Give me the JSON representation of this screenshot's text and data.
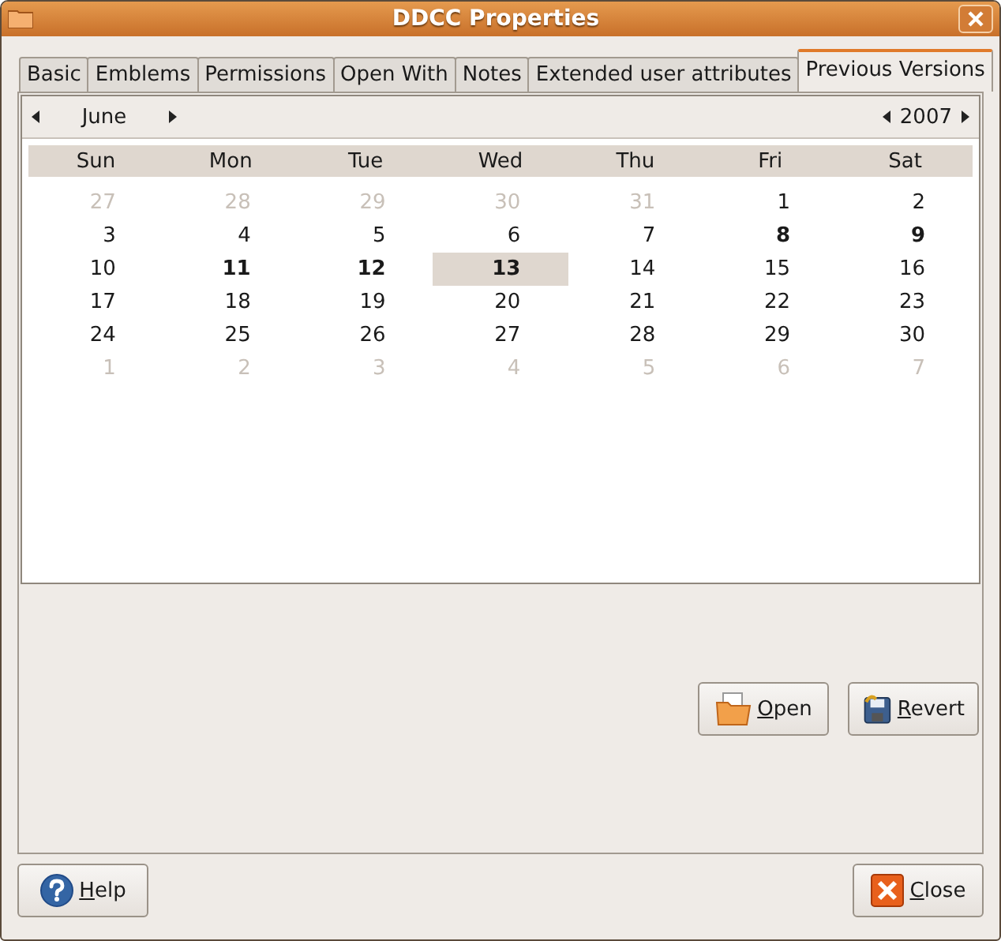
{
  "window": {
    "title": "DDCC Properties"
  },
  "tabs": [
    {
      "label": "Basic",
      "selected": false
    },
    {
      "label": "Emblems",
      "selected": false
    },
    {
      "label": "Permissions",
      "selected": false
    },
    {
      "label": "Open With",
      "selected": false
    },
    {
      "label": "Notes",
      "selected": false
    },
    {
      "label": "Extended user attributes",
      "selected": false
    },
    {
      "label": "Previous Versions",
      "selected": true
    }
  ],
  "calendar": {
    "month": "June",
    "year": "2007",
    "weekdays": [
      "Sun",
      "Mon",
      "Tue",
      "Wed",
      "Thu",
      "Fri",
      "Sat"
    ],
    "weeks": [
      [
        {
          "day": "27",
          "kind": "other",
          "marked": false,
          "selected": false
        },
        {
          "day": "28",
          "kind": "other",
          "marked": false,
          "selected": false
        },
        {
          "day": "29",
          "kind": "other",
          "marked": false,
          "selected": false
        },
        {
          "day": "30",
          "kind": "other",
          "marked": false,
          "selected": false
        },
        {
          "day": "31",
          "kind": "other",
          "marked": false,
          "selected": false
        },
        {
          "day": "1",
          "kind": "current",
          "marked": false,
          "selected": false
        },
        {
          "day": "2",
          "kind": "current",
          "marked": false,
          "selected": false
        }
      ],
      [
        {
          "day": "3",
          "kind": "current",
          "marked": false,
          "selected": false
        },
        {
          "day": "4",
          "kind": "current",
          "marked": false,
          "selected": false
        },
        {
          "day": "5",
          "kind": "current",
          "marked": false,
          "selected": false
        },
        {
          "day": "6",
          "kind": "current",
          "marked": false,
          "selected": false
        },
        {
          "day": "7",
          "kind": "current",
          "marked": false,
          "selected": false
        },
        {
          "day": "8",
          "kind": "current",
          "marked": true,
          "selected": false
        },
        {
          "day": "9",
          "kind": "current",
          "marked": true,
          "selected": false
        }
      ],
      [
        {
          "day": "10",
          "kind": "current",
          "marked": false,
          "selected": false
        },
        {
          "day": "11",
          "kind": "current",
          "marked": true,
          "selected": false
        },
        {
          "day": "12",
          "kind": "current",
          "marked": true,
          "selected": false
        },
        {
          "day": "13",
          "kind": "current",
          "marked": true,
          "selected": true
        },
        {
          "day": "14",
          "kind": "current",
          "marked": false,
          "selected": false
        },
        {
          "day": "15",
          "kind": "current",
          "marked": false,
          "selected": false
        },
        {
          "day": "16",
          "kind": "current",
          "marked": false,
          "selected": false
        }
      ],
      [
        {
          "day": "17",
          "kind": "current",
          "marked": false,
          "selected": false
        },
        {
          "day": "18",
          "kind": "current",
          "marked": false,
          "selected": false
        },
        {
          "day": "19",
          "kind": "current",
          "marked": false,
          "selected": false
        },
        {
          "day": "20",
          "kind": "current",
          "marked": false,
          "selected": false
        },
        {
          "day": "21",
          "kind": "current",
          "marked": false,
          "selected": false
        },
        {
          "day": "22",
          "kind": "current",
          "marked": false,
          "selected": false
        },
        {
          "day": "23",
          "kind": "current",
          "marked": false,
          "selected": false
        }
      ],
      [
        {
          "day": "24",
          "kind": "current",
          "marked": false,
          "selected": false
        },
        {
          "day": "25",
          "kind": "current",
          "marked": false,
          "selected": false
        },
        {
          "day": "26",
          "kind": "current",
          "marked": false,
          "selected": false
        },
        {
          "day": "27",
          "kind": "current",
          "marked": false,
          "selected": false
        },
        {
          "day": "28",
          "kind": "current",
          "marked": false,
          "selected": false
        },
        {
          "day": "29",
          "kind": "current",
          "marked": false,
          "selected": false
        },
        {
          "day": "30",
          "kind": "current",
          "marked": false,
          "selected": false
        }
      ],
      [
        {
          "day": "1",
          "kind": "other",
          "marked": false,
          "selected": false
        },
        {
          "day": "2",
          "kind": "other",
          "marked": false,
          "selected": false
        },
        {
          "day": "3",
          "kind": "other",
          "marked": false,
          "selected": false
        },
        {
          "day": "4",
          "kind": "other",
          "marked": false,
          "selected": false
        },
        {
          "day": "5",
          "kind": "other",
          "marked": false,
          "selected": false
        },
        {
          "day": "6",
          "kind": "other",
          "marked": false,
          "selected": false
        },
        {
          "day": "7",
          "kind": "other",
          "marked": false,
          "selected": false
        }
      ]
    ]
  },
  "actions": [
    {
      "kind": "open",
      "mnemonic": "O",
      "rest": "pen"
    },
    {
      "kind": "revert",
      "mnemonic": "R",
      "rest": "evert"
    }
  ],
  "footer": [
    {
      "kind": "help",
      "mnemonic": "H",
      "rest": "elp"
    },
    {
      "kind": "close",
      "mnemonic": "C",
      "rest": "lose"
    }
  ]
}
